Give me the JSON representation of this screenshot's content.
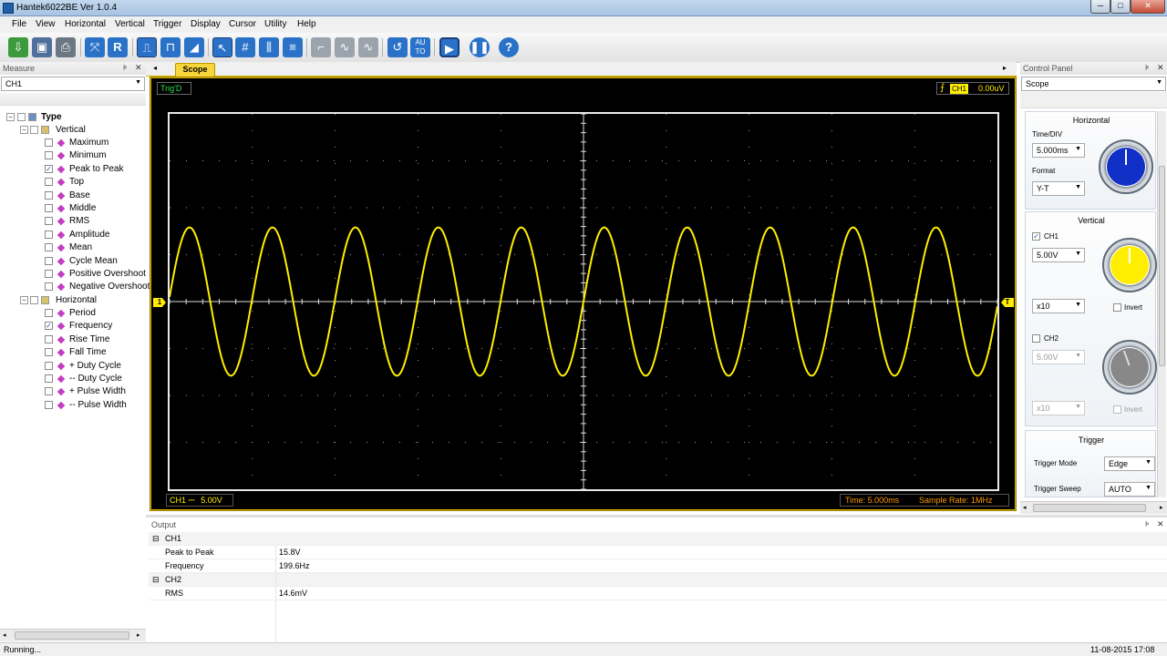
{
  "window": {
    "title": "Hantek6022BE Ver 1.0.4",
    "min": "─",
    "max": "□",
    "close": "✕"
  },
  "menu": [
    "File",
    "View",
    "Horizontal",
    "Vertical",
    "Trigger",
    "Display",
    "Cursor",
    "Utility",
    "Help"
  ],
  "toolbar": {
    "auto_label": "AU\nTO"
  },
  "measure_panel": {
    "title": "Measure",
    "channel": "CH1",
    "tree": {
      "root": "Type",
      "vertical": {
        "label": "Vertical",
        "items": [
          {
            "label": "Maximum",
            "checked": false
          },
          {
            "label": "Minimum",
            "checked": false
          },
          {
            "label": "Peak to Peak",
            "checked": true
          },
          {
            "label": "Top",
            "checked": false
          },
          {
            "label": "Base",
            "checked": false
          },
          {
            "label": "Middle",
            "checked": false
          },
          {
            "label": "RMS",
            "checked": false
          },
          {
            "label": "Amplitude",
            "checked": false
          },
          {
            "label": "Mean",
            "checked": false
          },
          {
            "label": "Cycle Mean",
            "checked": false
          },
          {
            "label": "Positive Overshoot",
            "checked": false
          },
          {
            "label": "Negative Overshoot",
            "checked": false
          }
        ]
      },
      "horizontal": {
        "label": "Horizontal",
        "items": [
          {
            "label": "Period",
            "checked": false
          },
          {
            "label": "Frequency",
            "checked": true
          },
          {
            "label": "Rise Time",
            "checked": false
          },
          {
            "label": "Fall Time",
            "checked": false
          },
          {
            "label": "+ Duty Cycle",
            "checked": false
          },
          {
            "label": "-- Duty Cycle",
            "checked": false
          },
          {
            "label": "+ Pulse Width",
            "checked": false
          },
          {
            "label": "-- Pulse Width",
            "checked": false
          }
        ]
      }
    }
  },
  "scope": {
    "tab": "Scope",
    "status": "Trig'D",
    "trigger_channel": "CH1",
    "trigger_level": "0.00uV",
    "ch1_label": "CH1",
    "ch1_coupling": "⎓",
    "ch1_scale": "5.00V",
    "time": "Time: 5.000ms",
    "sample_rate": "Sample Rate: 1MHz",
    "ch1_marker": "1",
    "trig_marker": "T",
    "trace_color": "#ffee00"
  },
  "control_panel": {
    "title": "Control Panel",
    "mode": "Scope",
    "horizontal": {
      "title": "Horizontal",
      "timediv_label": "Time/DIV",
      "timediv": "5.000ms",
      "format_label": "Format",
      "format": "Y-T"
    },
    "vertical": {
      "title": "Vertical",
      "ch1": {
        "label": "CH1",
        "enabled": true,
        "volts": "5.00V",
        "probe": "x10",
        "invert_label": "Invert"
      },
      "ch2": {
        "label": "CH2",
        "enabled": false,
        "volts": "5.00V",
        "probe": "x10",
        "invert_label": "Invert"
      }
    },
    "trigger": {
      "title": "Trigger",
      "mode_label": "Trigger Mode",
      "mode": "Edge",
      "sweep_label": "Trigger Sweep",
      "sweep": "AUTO"
    }
  },
  "output": {
    "title": "Output",
    "ch1": {
      "label": "CH1",
      "rows": [
        {
          "name": "Peak to Peak",
          "value": "15.8V"
        },
        {
          "name": "Frequency",
          "value": "199.6Hz"
        }
      ]
    },
    "ch2": {
      "label": "CH2",
      "rows": [
        {
          "name": "RMS",
          "value": "14.6mV"
        }
      ]
    }
  },
  "statusbar": {
    "left": "Running...",
    "right": "11-08-2015  17:08"
  },
  "colors": {
    "accent": "#d9b100",
    "trace": "#ffee00",
    "ch1_knob": "#ffee00",
    "time_knob": "#1030c8",
    "ch2_knob": "#888888"
  }
}
